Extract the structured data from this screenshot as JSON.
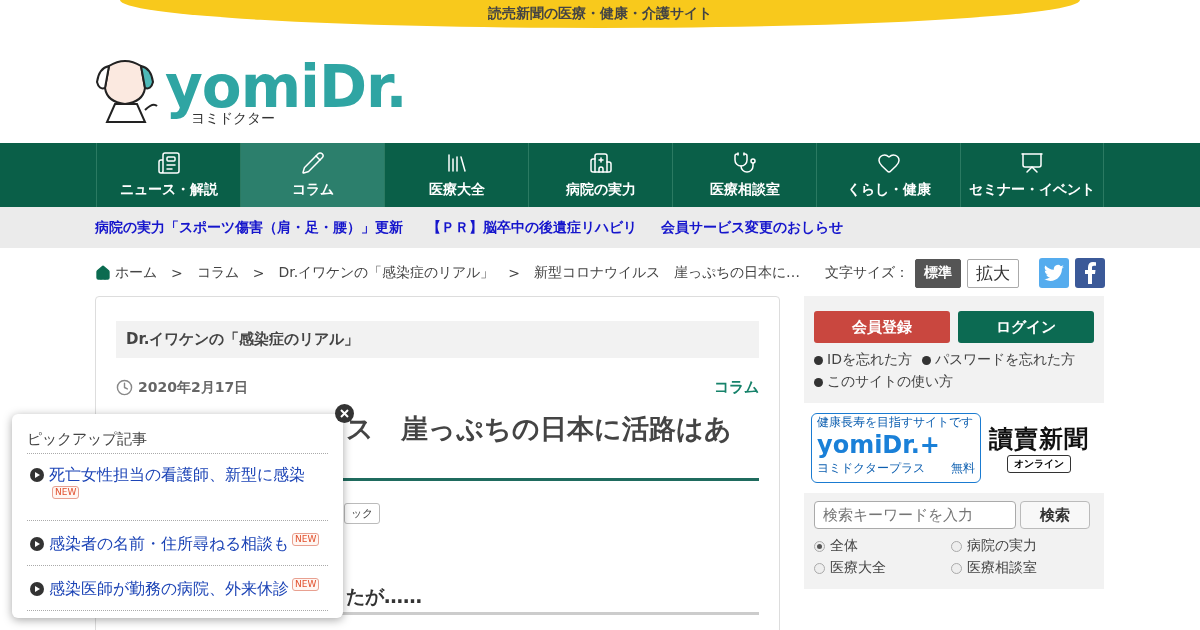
{
  "top_banner": {
    "text": "読売新聞の医療・健康・介護サイト"
  },
  "logo": {
    "wordmark": "yomiDr.",
    "subtitle": "ヨミドクター"
  },
  "nav": [
    {
      "label": "ニュース・解説",
      "kind": "news",
      "selected": false
    },
    {
      "label": "コラム",
      "kind": "pencil",
      "selected": true
    },
    {
      "label": "医療大全",
      "kind": "books",
      "selected": false
    },
    {
      "label": "病院の実力",
      "kind": "hospital",
      "selected": false
    },
    {
      "label": "医療相談室",
      "kind": "stethoscope",
      "selected": false
    },
    {
      "label": "くらし・健康",
      "kind": "heart",
      "selected": false
    },
    {
      "label": "セミナー・イベント",
      "kind": "seminar",
      "selected": false
    }
  ],
  "ticker": [
    "病院の実力「スポーツ傷害（肩・足・腰）」更新",
    "【ＰＲ】脳卒中の後遺症リハビリ",
    "会員サービス変更のおしらせ"
  ],
  "breadcrumb": [
    {
      "label": "ホーム",
      "kind": "home"
    },
    {
      "label": "コラム",
      "kind": "link",
      "separator": ">"
    },
    {
      "label": "Dr.イワケンの「感染症のリアル」",
      "kind": "link",
      "separator": ">"
    },
    {
      "label": "新型コロナウイルス　崖っぷちの日本に…",
      "kind": "current",
      "separator": ">"
    }
  ],
  "font_size": {
    "label": "文字サイズ：",
    "options": [
      {
        "label": "標準",
        "selected": true
      },
      {
        "label": "拡大",
        "selected": false
      }
    ]
  },
  "social": [
    {
      "kind": "twitter"
    },
    {
      "kind": "facebook"
    }
  ],
  "article": {
    "series": "Dr.イワケンの「感染症のリアル」",
    "date": "2020年2月17日",
    "category": "コラム",
    "title": "ス　崖っぷちの日本に活路はあ",
    "tag": "ック",
    "subheading": "たが……"
  },
  "account": {
    "buttons": [
      {
        "label": "会員登録",
        "kind": "register"
      },
      {
        "label": "ログイン",
        "kind": "login"
      }
    ],
    "links": [
      "IDを忘れた方",
      "パスワードを忘れた方",
      "このサイトの使い方"
    ]
  },
  "banners": {
    "plus": {
      "tagline": "健康長寿を目指すサイトです",
      "wordmark": "yomiDr.+",
      "subtitle": "ヨミドクタープラス",
      "badge": "無料"
    },
    "yomiuri": {
      "name": "讀賣新聞",
      "badge": "オンライン"
    }
  },
  "search": {
    "placeholder": "検索キーワードを入力",
    "button": "検索",
    "scopes": [
      {
        "label": "全体",
        "selected": true
      },
      {
        "label": "病院の実力",
        "selected": false
      },
      {
        "label": "医療大全",
        "selected": false
      },
      {
        "label": "医療相談室",
        "selected": false
      }
    ]
  },
  "popup": {
    "title": "ピックアップ記事",
    "items": [
      {
        "text": "死亡女性担当の看護師、新型に感染",
        "badge": "NEW"
      },
      {
        "text": "感染者の名前・住所尋ねる相談も",
        "badge": "NEW"
      },
      {
        "text": "感染医師が勤務の病院、外来休診",
        "badge": "NEW"
      }
    ]
  }
}
